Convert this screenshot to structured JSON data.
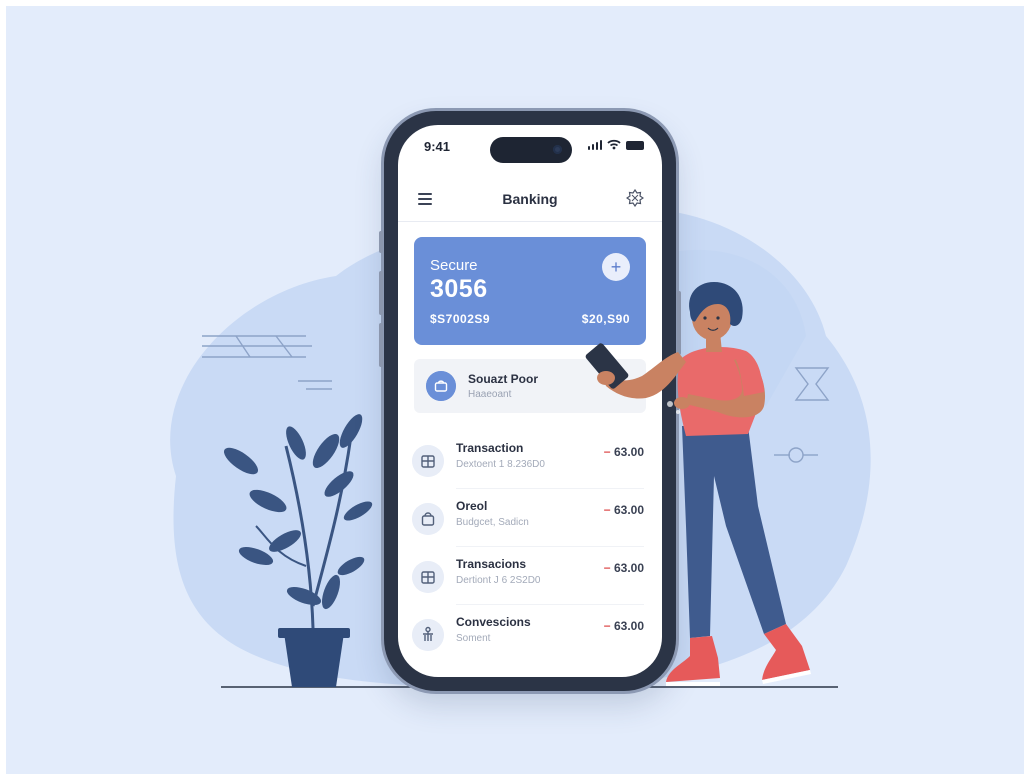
{
  "status_bar": {
    "time": "9:41"
  },
  "app": {
    "title": "Banking"
  },
  "card": {
    "label": "Secure",
    "number": "3056",
    "left_amount": "$S7002S9",
    "right_amount": "$20,S90",
    "add_symbol": "+"
  },
  "account": {
    "title": "Souazt Poor",
    "subtitle": "Haaeoant"
  },
  "transactions": [
    {
      "title": "Transaction",
      "subtitle": "Dextoent 1 8.236D0",
      "amount_sign": "−",
      "amount": "63.00",
      "icon": "bank-icon"
    },
    {
      "title": "Oreol",
      "subtitle": "Budgcet, Sadicn",
      "amount_sign": "−",
      "amount": "63.00",
      "icon": "bag-icon"
    },
    {
      "title": "Transacions",
      "subtitle": "Dertiont J 6 2S2D0",
      "amount_sign": "−",
      "amount": "63.00",
      "icon": "bank-icon"
    },
    {
      "title": "Convescions",
      "subtitle": "Soment",
      "amount_sign": "−",
      "amount": "63.00",
      "icon": "person-icon"
    }
  ],
  "colors": {
    "background": "#e3ecfb",
    "blob": "#c9daf5",
    "card": "#6a8fd8",
    "accent_negative": "#e05757",
    "plant": "#3a5582",
    "person_shirt": "#e96a6a",
    "person_pants": "#3f5b8e",
    "person_shoes": "#e65a5a"
  }
}
